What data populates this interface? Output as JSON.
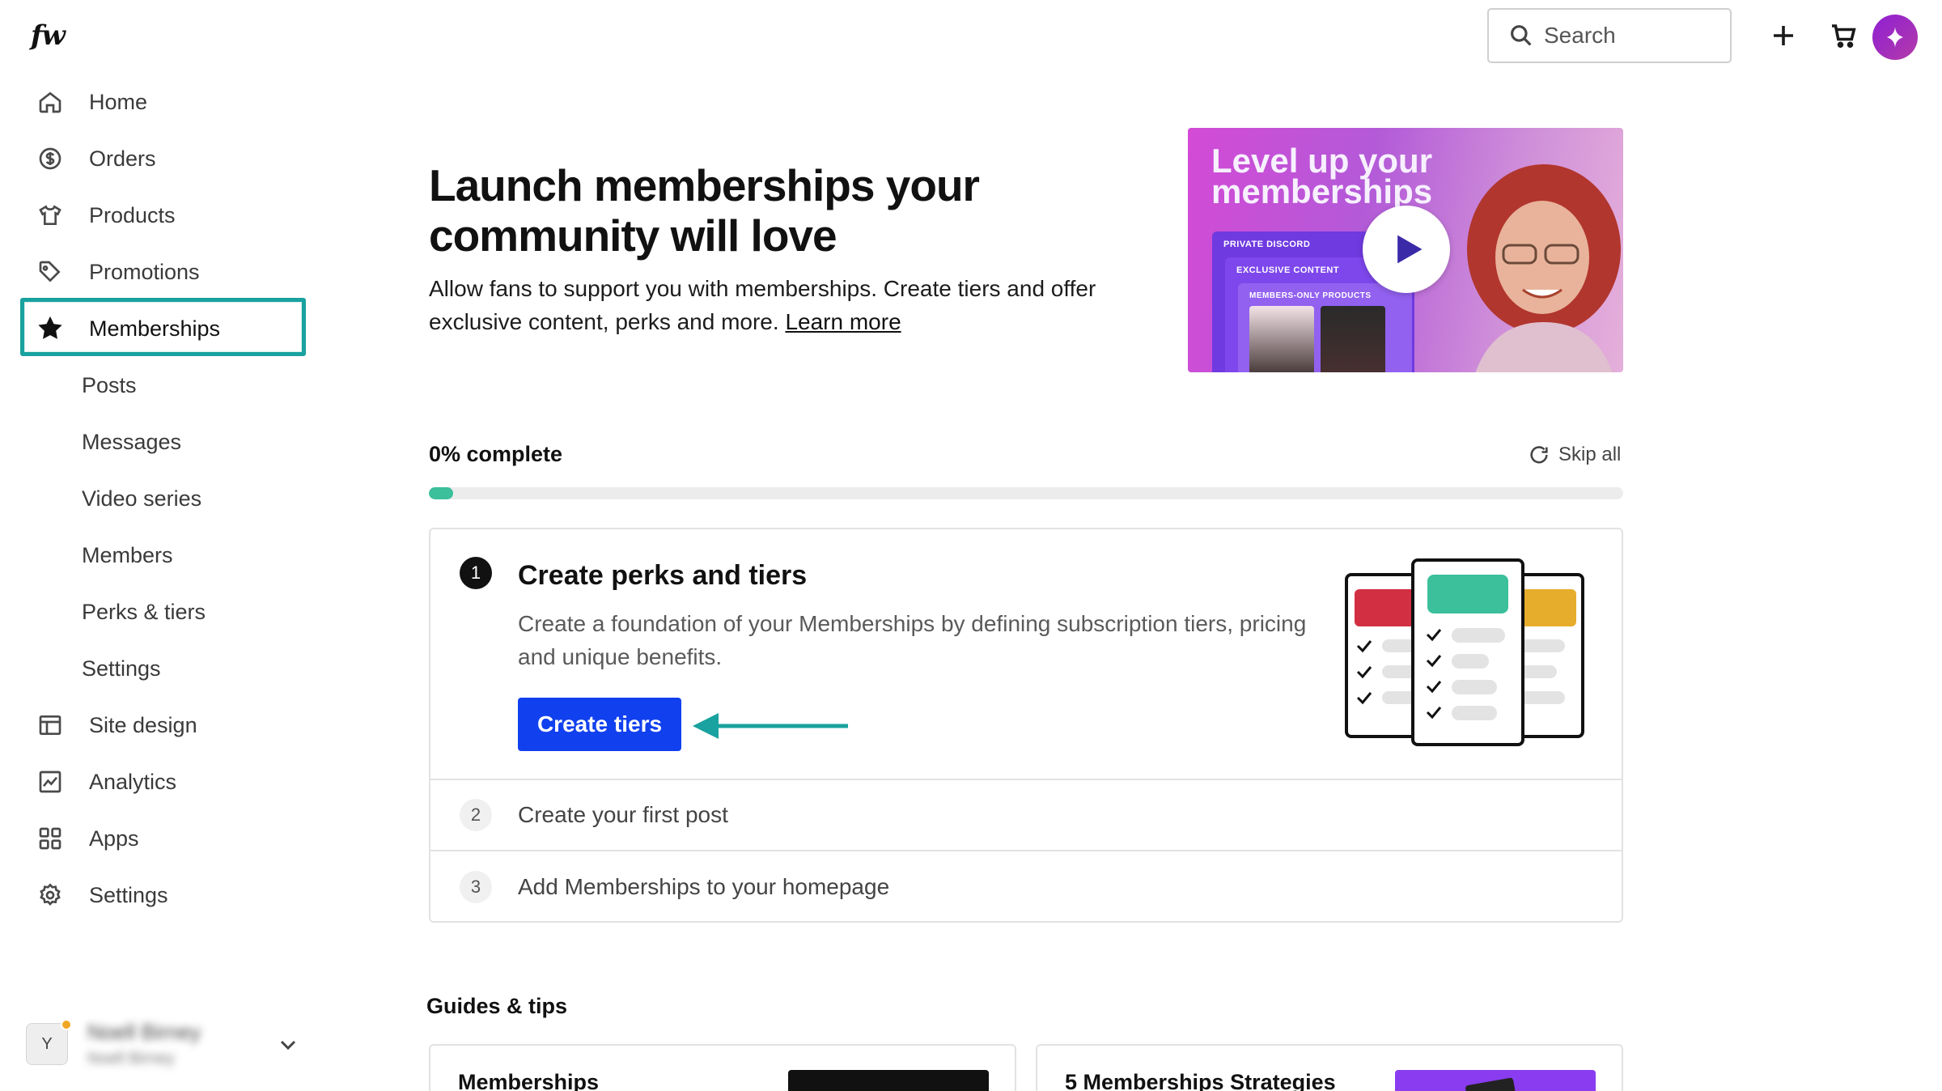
{
  "app": {
    "logo_text": "fw"
  },
  "sidebar": {
    "items": [
      {
        "label": "Home",
        "icon": "home-icon"
      },
      {
        "label": "Orders",
        "icon": "dollar-circle-icon"
      },
      {
        "label": "Products",
        "icon": "tshirt-icon"
      },
      {
        "label": "Promotions",
        "icon": "tag-icon"
      },
      {
        "label": "Memberships",
        "icon": "star-icon",
        "active": true
      },
      {
        "label": "Posts",
        "sub": true
      },
      {
        "label": "Messages",
        "sub": true
      },
      {
        "label": "Video series",
        "sub": true
      },
      {
        "label": "Members",
        "sub": true
      },
      {
        "label": "Perks & tiers",
        "sub": true
      },
      {
        "label": "Settings",
        "sub": true
      },
      {
        "label": "Site design",
        "icon": "layout-icon"
      },
      {
        "label": "Analytics",
        "icon": "chart-icon"
      },
      {
        "label": "Apps",
        "icon": "grid-icon"
      },
      {
        "label": "Settings",
        "icon": "gear-icon"
      }
    ],
    "account": {
      "avatar_letter": "Y",
      "name": "Noell Birney",
      "sub": "Noell Birney"
    }
  },
  "topbar": {
    "search_placeholder": "Search",
    "icons": [
      "search-icon",
      "plus-icon",
      "cart-icon",
      "sparkle-icon"
    ]
  },
  "hero": {
    "title": "Launch memberships your community will love",
    "description": "Allow fans to support you with memberships. Create tiers and offer exclusive content, perks and more.",
    "learn_more": "Learn more",
    "video": {
      "title": "Level up your memberships",
      "labels": [
        "PRIVATE DISCORD",
        "EXCLUSIVE CONTENT",
        "MEMBERS-ONLY PRODUCTS"
      ]
    }
  },
  "progress": {
    "label": "0% complete",
    "value": 0.02,
    "skip_label": "Skip all"
  },
  "steps": [
    {
      "number": "1",
      "title": "Create perks and tiers",
      "description": "Create a foundation of your Memberships by defining subscription tiers, pricing and unique benefits.",
      "cta": "Create tiers"
    },
    {
      "number": "2",
      "title": "Create your first post"
    },
    {
      "number": "3",
      "title": "Add Memberships to your homepage"
    }
  ],
  "guides": {
    "title": "Guides & tips",
    "cards": [
      {
        "title": "Memberships"
      },
      {
        "title": "5 Memberships Strategies"
      }
    ]
  },
  "colors": {
    "accent_teal": "#19a29f",
    "primary_blue": "#1140ef",
    "progress_green": "#3cbf9b"
  }
}
